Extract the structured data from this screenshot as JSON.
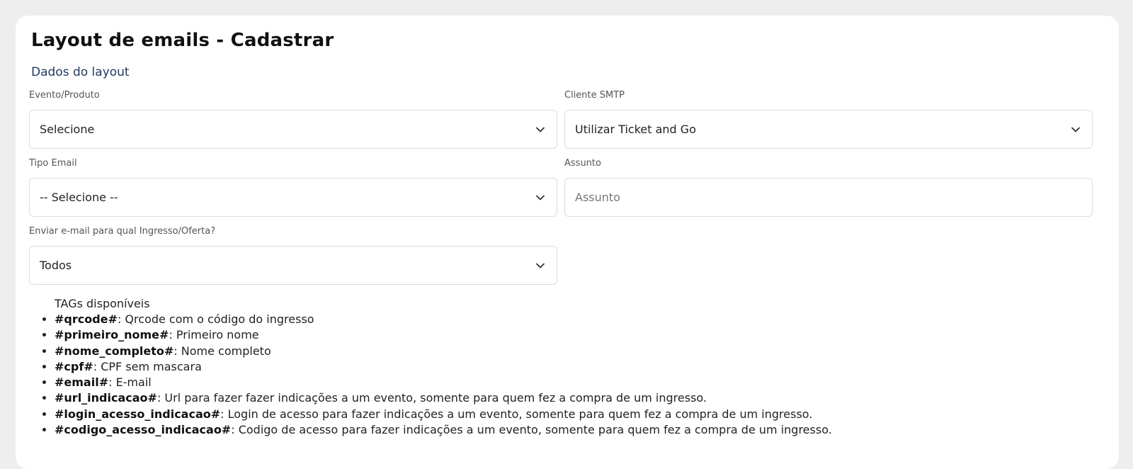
{
  "page": {
    "title": "Layout de emails - Cadastrar",
    "section_title": "Dados do layout"
  },
  "form": {
    "evento_produto": {
      "label": "Evento/Produto",
      "value": "Selecione"
    },
    "cliente_smtp": {
      "label": "Cliente SMTP",
      "value": "Utilizar Ticket and Go"
    },
    "tipo_email": {
      "label": "Tipo Email",
      "value": "-- Selecione --"
    },
    "assunto": {
      "label": "Assunto",
      "placeholder": "Assunto",
      "value": ""
    },
    "enviar_para": {
      "label": "Enviar e-mail para qual Ingresso/Oferta?",
      "value": "Todos"
    }
  },
  "tags": {
    "heading": "TAGs disponíveis",
    "items": [
      {
        "tag": "#qrcode#",
        "description": ": Qrcode com o código do ingresso"
      },
      {
        "tag": "#primeiro_nome#",
        "description": ": Primeiro nome"
      },
      {
        "tag": "#nome_completo#",
        "description": ": Nome completo"
      },
      {
        "tag": "#cpf#",
        "description": ": CPF sem mascara"
      },
      {
        "tag": "#email#",
        "description": ": E-mail"
      },
      {
        "tag": "#url_indicacao#",
        "description": ": Url para fazer fazer indicações a um evento, somente para quem fez a compra de um ingresso."
      },
      {
        "tag": "#login_acesso_indicacao#",
        "description": ": Login de acesso para fazer indicações a um evento, somente para quem fez a compra de um ingresso."
      },
      {
        "tag": "#codigo_acesso_indicacao#",
        "description": ": Codigo de acesso para fazer indicações a um evento, somente para quem fez a compra de um ingresso."
      }
    ]
  },
  "icons": {
    "select_arrow": "chevron-down-icon"
  },
  "colors": {
    "background": "#eeeeee",
    "card": "#ffffff",
    "section_title": "#1f3b63",
    "border": "#dcdcdc"
  }
}
